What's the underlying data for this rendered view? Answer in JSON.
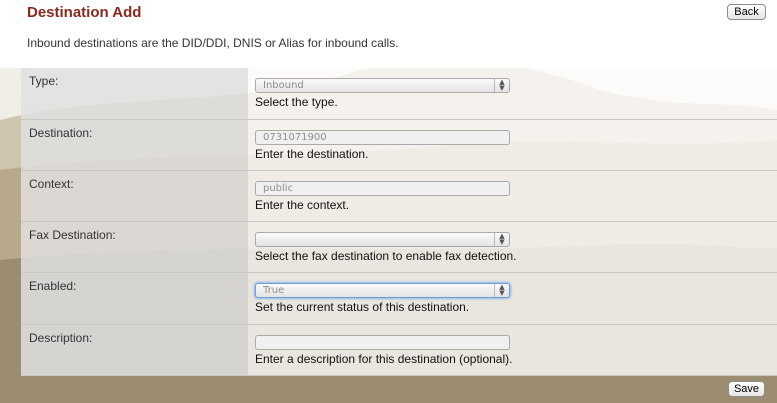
{
  "page": {
    "title": "Destination Add",
    "description": "Inbound destinations are the DID/DDI, DNIS or Alias for inbound calls.",
    "back_label": "Back",
    "save_label": "Save"
  },
  "fields": {
    "type": {
      "label": "Type:",
      "value": "Inbound",
      "hint": "Select the type."
    },
    "destination": {
      "label": "Destination:",
      "value": "0731071900",
      "hint": "Enter the destination."
    },
    "context": {
      "label": "Context:",
      "value": "public",
      "hint": "Enter the context."
    },
    "fax": {
      "label": "Fax Destination:",
      "value": "",
      "hint": "Select the fax destination to enable fax detection."
    },
    "enabled": {
      "label": "Enabled:",
      "value": "True",
      "hint": "Set the current status of this destination."
    },
    "description": {
      "label": "Description:",
      "value": "",
      "hint": "Enter a description for this destination (optional)."
    }
  },
  "colors": {
    "title": "#8a2a1e"
  },
  "icons": {
    "select_arrow": "up-down-arrows-icon"
  }
}
